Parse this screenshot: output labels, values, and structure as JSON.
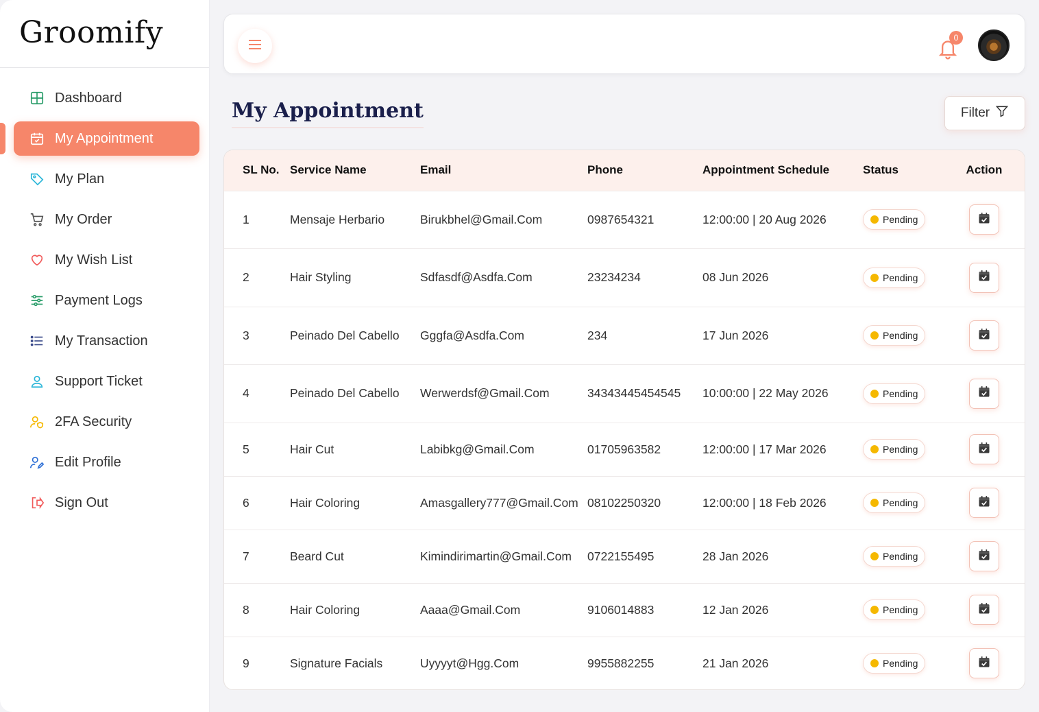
{
  "brand": {
    "name": "Groomify"
  },
  "sidebar": {
    "items": [
      {
        "label": "Dashboard",
        "icon": "grid-icon",
        "active": false
      },
      {
        "label": "My Appointment",
        "icon": "calendar-icon",
        "active": true
      },
      {
        "label": "My Plan",
        "icon": "tag-icon",
        "active": false
      },
      {
        "label": "My Order",
        "icon": "cart-icon",
        "active": false
      },
      {
        "label": "My Wish List",
        "icon": "heart-icon",
        "active": false
      },
      {
        "label": "Payment Logs",
        "icon": "sliders-icon",
        "active": false
      },
      {
        "label": "My Transaction",
        "icon": "list-icon",
        "active": false
      },
      {
        "label": "Support Ticket",
        "icon": "user-icon",
        "active": false
      },
      {
        "label": "2FA Security",
        "icon": "user-shield-icon",
        "active": false
      },
      {
        "label": "Edit Profile",
        "icon": "user-edit-icon",
        "active": false
      },
      {
        "label": "Sign Out",
        "icon": "sign-out-icon",
        "active": false
      }
    ]
  },
  "header": {
    "notification_count": "0"
  },
  "main": {
    "title": "My Appointment",
    "filter_label": "Filter",
    "columns": [
      "SL No.",
      "Service Name",
      "Email",
      "Phone",
      "Appointment Schedule",
      "Status",
      "Action"
    ],
    "rows": [
      {
        "sl": "1",
        "service": "Mensaje Herbario",
        "email": "Birukbhel@Gmail.Com",
        "phone": "0987654321",
        "schedule": "12:00:00 | 20 Aug 2026",
        "status": "Pending"
      },
      {
        "sl": "2",
        "service": "Hair Styling",
        "email": "Sdfasdf@Asdfa.Com",
        "phone": "23234234",
        "schedule": "08 Jun 2026",
        "status": "Pending"
      },
      {
        "sl": "3",
        "service": "Peinado Del Cabello",
        "email": "Gggfa@Asdfa.Com",
        "phone": "234",
        "schedule": "17 Jun 2026",
        "status": "Pending"
      },
      {
        "sl": "4",
        "service": "Peinado Del Cabello",
        "email": "Werwerdsf@Gmail.Com",
        "phone": "34343445454545",
        "schedule": "10:00:00 | 22 May 2026",
        "status": "Pending"
      },
      {
        "sl": "5",
        "service": "Hair Cut",
        "email": "Labibkg@Gmail.Com",
        "phone": "01705963582",
        "schedule": "12:00:00 | 17 Mar 2026",
        "status": "Pending"
      },
      {
        "sl": "6",
        "service": "Hair Coloring",
        "email": "Amasgallery777@Gmail.Com",
        "phone": "08102250320",
        "schedule": "12:00:00 | 18 Feb 2026",
        "status": "Pending"
      },
      {
        "sl": "7",
        "service": "Beard Cut",
        "email": "Kimindirimartin@Gmail.Com",
        "phone": "0722155495",
        "schedule": "28 Jan 2026",
        "status": "Pending"
      },
      {
        "sl": "8",
        "service": "Hair Coloring",
        "email": "Aaaa@Gmail.Com",
        "phone": "9106014883",
        "schedule": "12 Jan 2026",
        "status": "Pending"
      },
      {
        "sl": "9",
        "service": "Signature Facials",
        "email": "Uyyyyt@Hgg.Com",
        "phone": "9955882255",
        "schedule": "21 Jan 2026",
        "status": "Pending"
      }
    ]
  },
  "colors": {
    "accent": "#f6866a",
    "pending": "#f5b800",
    "title": "#1a1f4b"
  }
}
